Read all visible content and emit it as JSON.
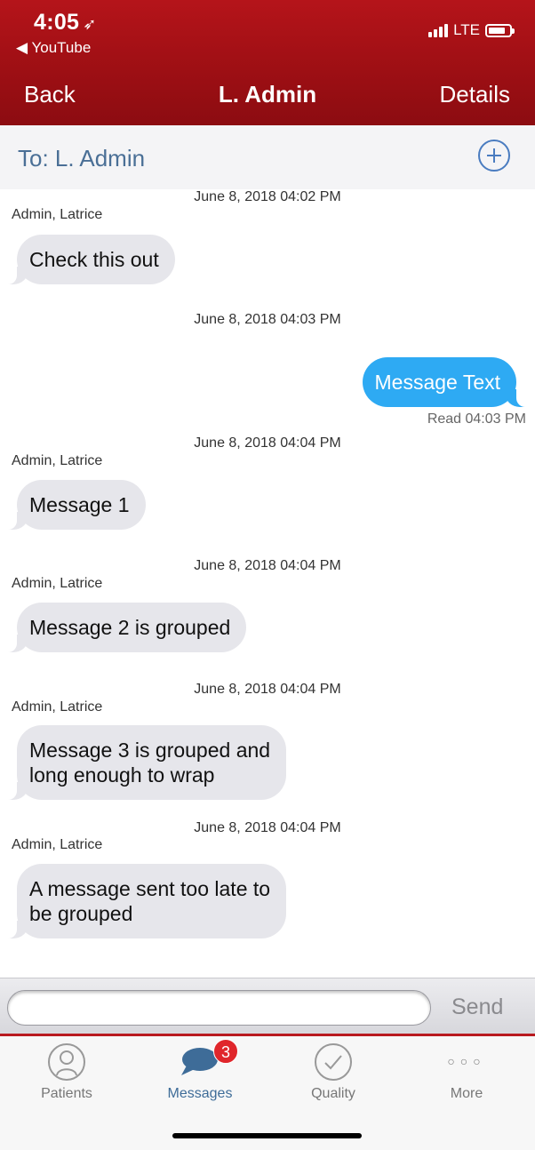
{
  "status_bar": {
    "time": "4:05",
    "location_arrow": "➶",
    "back_app": "◀ YouTube",
    "network": "LTE"
  },
  "nav": {
    "back_label": "Back",
    "title": "L. Admin",
    "details_label": "Details"
  },
  "to_bar": {
    "label": "To:  L. Admin",
    "add_icon": "plus-circle-icon"
  },
  "messages": [
    {
      "timestamp": "June 8, 2018 04:02 PM",
      "sender": "Admin, Latrice",
      "text": "Check this out",
      "direction": "incoming"
    },
    {
      "timestamp": "June 8, 2018 04:03 PM",
      "text": "Message Text",
      "direction": "outgoing",
      "receipt": "Read 04:03 PM"
    },
    {
      "timestamp": "June 8, 2018 04:04 PM",
      "sender": "Admin, Latrice",
      "text": "Message 1",
      "direction": "incoming"
    },
    {
      "timestamp": "June 8, 2018 04:04 PM",
      "sender": "Admin, Latrice",
      "text": "Message 2 is grouped",
      "direction": "incoming"
    },
    {
      "timestamp": "June 8, 2018 04:04 PM",
      "sender": "Admin, Latrice",
      "text": "Message 3 is grouped and long enough to wrap",
      "line1": "Message 3 is grouped and",
      "line2": "long enough to wrap",
      "direction": "incoming"
    },
    {
      "timestamp": "June 8, 2018 04:04 PM",
      "sender": "Admin, Latrice",
      "text": "A message sent too late to be grouped",
      "line1": "A message sent too late to",
      "line2": "be grouped",
      "direction": "incoming"
    }
  ],
  "compose": {
    "input_value": "",
    "send_label": "Send"
  },
  "tabs": [
    {
      "label": "Patients",
      "icon": "person-icon",
      "active": false
    },
    {
      "label": "Messages",
      "icon": "chat-bubble-icon",
      "active": true,
      "badge": "3"
    },
    {
      "label": "Quality",
      "icon": "checkmark-icon",
      "active": false
    },
    {
      "label": "More",
      "icon": "more-dots-icon",
      "active": false
    }
  ],
  "colors": {
    "header": "#a51217",
    "outgoing_bubble": "#2eaaf3",
    "incoming_bubble": "#e6e6eb",
    "link_blue": "#4a6f96",
    "badge": "#e0262b"
  }
}
